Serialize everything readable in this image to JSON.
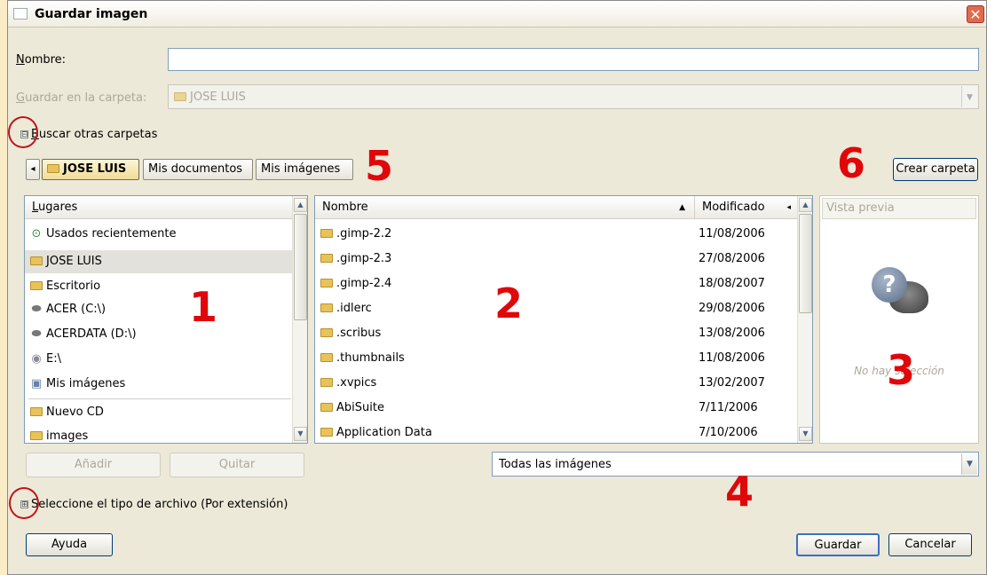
{
  "window": {
    "title": "Guardar imagen",
    "close_glyph": "✕"
  },
  "name_field": {
    "label": "Nombre:",
    "value": ""
  },
  "save_in": {
    "label": "Guardar en la carpeta:",
    "value": "JOSE LUIS"
  },
  "browse_toggle": {
    "label": "Buscar otras carpetas",
    "glyph": "⊟"
  },
  "path_bar": {
    "back_glyph": "◂",
    "items": [
      "JOSE LUIS",
      "Mis documentos",
      "Mis imágenes"
    ]
  },
  "create_folder_label": "Crear carpeta",
  "places": {
    "header": "Lugares",
    "items": [
      {
        "label": "Usados recientemente",
        "icon": "recent-icon"
      },
      {
        "label": "JOSE LUIS",
        "icon": "folder-icon"
      },
      {
        "label": "Escritorio",
        "icon": "folder-icon"
      },
      {
        "label": "ACER (C:\\)",
        "icon": "drive-icon"
      },
      {
        "label": "ACERDATA (D:\\)",
        "icon": "drive-icon"
      },
      {
        "label": "E:\\",
        "icon": "cdrom-icon"
      },
      {
        "label": "Mis imágenes",
        "icon": "pictures-icon"
      },
      {
        "label": "Nuevo CD",
        "icon": "folder-icon"
      },
      {
        "label": "images",
        "icon": "folder-icon"
      }
    ],
    "add_label": "Añadir",
    "remove_label": "Quitar"
  },
  "files": {
    "col_name": "Nombre",
    "col_modified": "Modificado",
    "sort_glyph": "▲",
    "rows": [
      {
        "name": ".gimp-2.2",
        "date": "11/08/2006"
      },
      {
        "name": ".gimp-2.3",
        "date": "27/08/2006"
      },
      {
        "name": ".gimp-2.4",
        "date": "18/08/2007"
      },
      {
        "name": ".idlerc",
        "date": "29/08/2006"
      },
      {
        "name": ".scribus",
        "date": "13/08/2006"
      },
      {
        "name": ".thumbnails",
        "date": "11/08/2006"
      },
      {
        "name": ".xvpics",
        "date": "13/02/2007"
      },
      {
        "name": "AbiSuite",
        "date": "7/11/2006"
      },
      {
        "name": "Application Data",
        "date": "7/10/2006"
      }
    ]
  },
  "preview": {
    "header": "Vista previa",
    "no_selection": "No hay selección"
  },
  "filter": {
    "value": "Todas las imágenes"
  },
  "file_type_toggle": {
    "label": "Seleccione el tipo de archivo (Por extensión)",
    "glyph": "⊞"
  },
  "buttons": {
    "help": "Ayuda",
    "save": "Guardar",
    "cancel": "Cancelar"
  },
  "annotations": [
    "1",
    "2",
    "3",
    "4",
    "5",
    "6"
  ],
  "colors": {
    "annotation_red": "#e0070a",
    "window_bg": "#ece9d8",
    "page_bg": "#fbecc8"
  }
}
